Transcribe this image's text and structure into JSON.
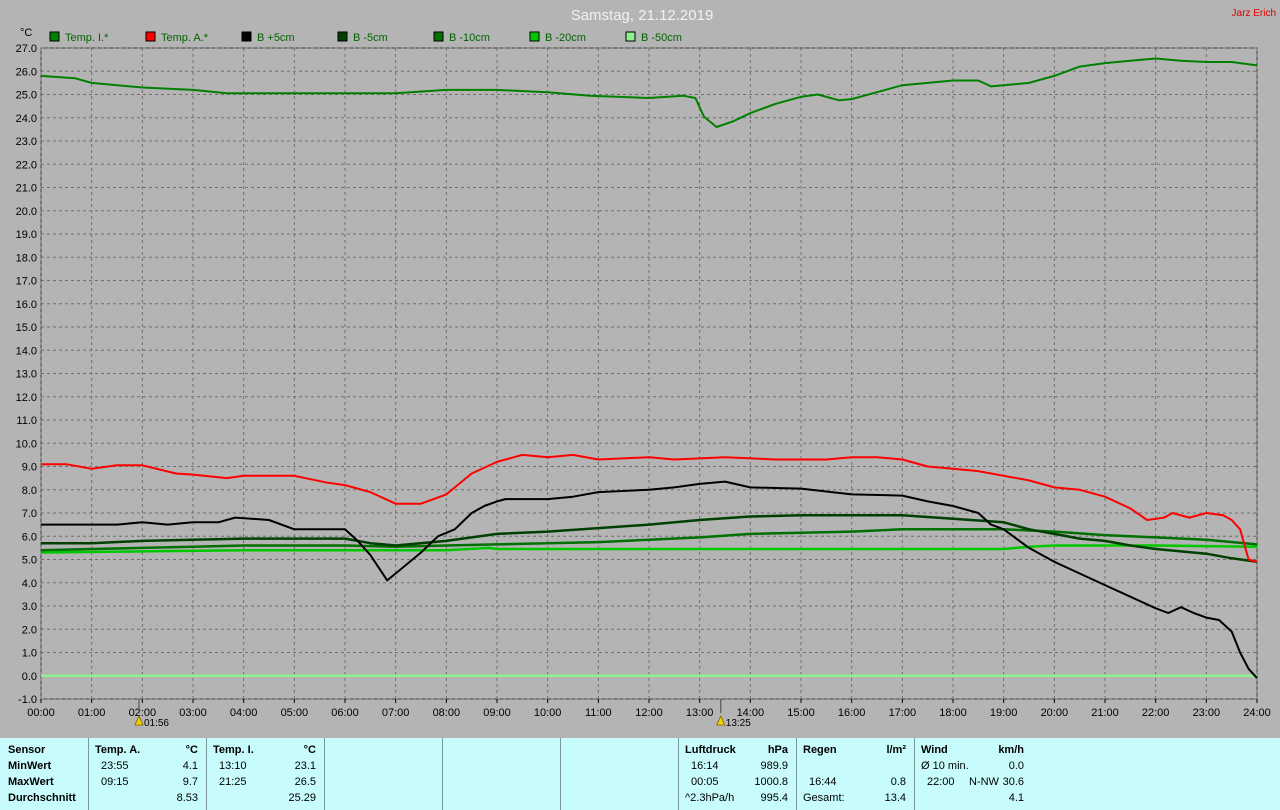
{
  "header": {
    "title": "Samstag, 21.12.2019",
    "credit": "Jarz Erich"
  },
  "colors": {
    "background": "#b4b4b4",
    "plot_background": "#b4b4b4",
    "grid": "#707070",
    "temp_inside": "#008000",
    "temp_outside": "#ff0000",
    "b_plus5": "#000000",
    "b_minus5": "#004000",
    "b_minus10": "#007000",
    "b_minus20": "#00c800",
    "b_minus50": "#90f090",
    "stats_background": "#c8fcfc"
  },
  "markers": [
    {
      "time": "01:56",
      "label": "01:56",
      "icon": "sunrise-icon"
    },
    {
      "time": "13:25",
      "label": "13:25",
      "icon": "sun-icon"
    }
  ],
  "chart_data": {
    "type": "line",
    "title": "Samstag, 21.12.2019",
    "ylabel": "°C",
    "xlabel": "",
    "xlim": [
      "00:00",
      "24:00"
    ],
    "ylim": [
      -1,
      27
    ],
    "grid": true,
    "legend_position": "top-left",
    "y_ticks": [
      "-1.0",
      "0.0",
      "1.0",
      "2.0",
      "3.0",
      "4.0",
      "5.0",
      "6.0",
      "7.0",
      "8.0",
      "9.0",
      "10.0",
      "11.0",
      "12.0",
      "13.0",
      "14.0",
      "15.0",
      "16.0",
      "17.0",
      "18.0",
      "19.0",
      "20.0",
      "21.0",
      "22.0",
      "23.0",
      "24.0",
      "25.0",
      "26.0",
      "27.0"
    ],
    "x_ticks": [
      "00:00",
      "01:00",
      "02:00",
      "03:00",
      "04:00",
      "05:00",
      "06:00",
      "07:00",
      "08:00",
      "09:00",
      "10:00",
      "11:00",
      "12:00",
      "13:00",
      "14:00",
      "15:00",
      "16:00",
      "17:00",
      "18:00",
      "19:00",
      "20:00",
      "21:00",
      "22:00",
      "23:00",
      "24:00"
    ],
    "series": [
      {
        "name": "Temp. I.*",
        "color": "#008000",
        "width": 2,
        "points": [
          [
            "00:00",
            25.8
          ],
          [
            "00:40",
            25.7
          ],
          [
            "01:00",
            25.5
          ],
          [
            "02:00",
            25.3
          ],
          [
            "03:00",
            25.2
          ],
          [
            "03:40",
            25.05
          ],
          [
            "05:00",
            25.05
          ],
          [
            "07:00",
            25.05
          ],
          [
            "08:00",
            25.2
          ],
          [
            "09:00",
            25.2
          ],
          [
            "10:00",
            25.1
          ],
          [
            "10:50",
            24.95
          ],
          [
            "12:00",
            24.85
          ],
          [
            "12:40",
            24.95
          ],
          [
            "12:55",
            24.85
          ],
          [
            "13:05",
            24.05
          ],
          [
            "13:20",
            23.6
          ],
          [
            "13:40",
            23.85
          ],
          [
            "14:00",
            24.2
          ],
          [
            "14:30",
            24.6
          ],
          [
            "15:00",
            24.9
          ],
          [
            "15:20",
            25.0
          ],
          [
            "15:45",
            24.75
          ],
          [
            "16:00",
            24.8
          ],
          [
            "16:30",
            25.1
          ],
          [
            "17:00",
            25.4
          ],
          [
            "17:30",
            25.5
          ],
          [
            "18:00",
            25.6
          ],
          [
            "18:30",
            25.6
          ],
          [
            "18:45",
            25.35
          ],
          [
            "19:00",
            25.4
          ],
          [
            "19:30",
            25.5
          ],
          [
            "20:00",
            25.8
          ],
          [
            "20:30",
            26.2
          ],
          [
            "21:00",
            26.35
          ],
          [
            "21:30",
            26.45
          ],
          [
            "22:00",
            26.55
          ],
          [
            "22:30",
            26.45
          ],
          [
            "23:00",
            26.4
          ],
          [
            "23:30",
            26.4
          ],
          [
            "24:00",
            26.25
          ]
        ]
      },
      {
        "name": "Temp. A.*",
        "color": "#ff0000",
        "width": 2,
        "points": [
          [
            "00:00",
            9.1
          ],
          [
            "00:30",
            9.1
          ],
          [
            "01:00",
            8.9
          ],
          [
            "01:30",
            9.05
          ],
          [
            "02:00",
            9.05
          ],
          [
            "02:40",
            8.7
          ],
          [
            "03:00",
            8.65
          ],
          [
            "03:40",
            8.5
          ],
          [
            "04:00",
            8.6
          ],
          [
            "05:00",
            8.6
          ],
          [
            "05:40",
            8.3
          ],
          [
            "06:00",
            8.2
          ],
          [
            "06:30",
            7.9
          ],
          [
            "07:00",
            7.4
          ],
          [
            "07:30",
            7.4
          ],
          [
            "08:00",
            7.8
          ],
          [
            "08:30",
            8.7
          ],
          [
            "09:00",
            9.2
          ],
          [
            "09:30",
            9.5
          ],
          [
            "10:00",
            9.4
          ],
          [
            "10:30",
            9.5
          ],
          [
            "11:00",
            9.3
          ],
          [
            "12:00",
            9.4
          ],
          [
            "12:30",
            9.3
          ],
          [
            "13:30",
            9.4
          ],
          [
            "14:30",
            9.3
          ],
          [
            "15:30",
            9.3
          ],
          [
            "16:00",
            9.4
          ],
          [
            "16:30",
            9.4
          ],
          [
            "17:00",
            9.3
          ],
          [
            "17:30",
            9.0
          ],
          [
            "18:00",
            8.9
          ],
          [
            "18:30",
            8.8
          ],
          [
            "19:00",
            8.6
          ],
          [
            "19:30",
            8.4
          ],
          [
            "20:00",
            8.1
          ],
          [
            "20:30",
            8.0
          ],
          [
            "21:00",
            7.7
          ],
          [
            "21:30",
            7.2
          ],
          [
            "21:50",
            6.7
          ],
          [
            "22:10",
            6.8
          ],
          [
            "22:20",
            7.0
          ],
          [
            "22:40",
            6.8
          ],
          [
            "23:00",
            7.0
          ],
          [
            "23:20",
            6.9
          ],
          [
            "23:30",
            6.7
          ],
          [
            "23:40",
            6.3
          ],
          [
            "23:50",
            5.0
          ],
          [
            "24:00",
            4.9
          ]
        ]
      },
      {
        "name": "B +5cm",
        "color": "#000000",
        "width": 2,
        "points": [
          [
            "00:00",
            6.5
          ],
          [
            "00:30",
            6.5
          ],
          [
            "01:00",
            6.5
          ],
          [
            "01:30",
            6.5
          ],
          [
            "02:00",
            6.6
          ],
          [
            "02:30",
            6.5
          ],
          [
            "03:00",
            6.6
          ],
          [
            "03:30",
            6.6
          ],
          [
            "03:50",
            6.8
          ],
          [
            "04:30",
            6.7
          ],
          [
            "05:00",
            6.3
          ],
          [
            "06:00",
            6.3
          ],
          [
            "06:15",
            5.8
          ],
          [
            "06:30",
            5.2
          ],
          [
            "06:50",
            4.1
          ],
          [
            "07:10",
            4.7
          ],
          [
            "07:30",
            5.3
          ],
          [
            "07:50",
            6.0
          ],
          [
            "08:10",
            6.3
          ],
          [
            "08:30",
            7.0
          ],
          [
            "08:45",
            7.3
          ],
          [
            "09:00",
            7.5
          ],
          [
            "09:10",
            7.6
          ],
          [
            "10:00",
            7.6
          ],
          [
            "10:30",
            7.7
          ],
          [
            "11:00",
            7.9
          ],
          [
            "12:00",
            8.0
          ],
          [
            "12:30",
            8.1
          ],
          [
            "13:00",
            8.25
          ],
          [
            "13:30",
            8.35
          ],
          [
            "14:00",
            8.1
          ],
          [
            "15:00",
            8.05
          ],
          [
            "16:00",
            7.8
          ],
          [
            "17:00",
            7.75
          ],
          [
            "17:30",
            7.5
          ],
          [
            "18:00",
            7.3
          ],
          [
            "18:30",
            7.0
          ],
          [
            "18:45",
            6.5
          ],
          [
            "19:00",
            6.3
          ],
          [
            "19:30",
            5.5
          ],
          [
            "20:00",
            4.9
          ],
          [
            "20:30",
            4.4
          ],
          [
            "21:00",
            3.9
          ],
          [
            "21:30",
            3.4
          ],
          [
            "22:00",
            2.9
          ],
          [
            "22:15",
            2.7
          ],
          [
            "22:30",
            2.95
          ],
          [
            "22:45",
            2.7
          ],
          [
            "23:00",
            2.5
          ],
          [
            "23:15",
            2.4
          ],
          [
            "23:30",
            1.9
          ],
          [
            "23:40",
            1.0
          ],
          [
            "23:50",
            0.3
          ],
          [
            "24:00",
            -0.1
          ]
        ]
      },
      {
        "name": "B -5cm",
        "color": "#004000",
        "width": 2.5,
        "points": [
          [
            "00:00",
            5.7
          ],
          [
            "01:00",
            5.7
          ],
          [
            "02:00",
            5.8
          ],
          [
            "03:00",
            5.85
          ],
          [
            "04:00",
            5.9
          ],
          [
            "05:00",
            5.9
          ],
          [
            "06:00",
            5.9
          ],
          [
            "06:30",
            5.7
          ],
          [
            "07:00",
            5.6
          ],
          [
            "08:00",
            5.8
          ],
          [
            "09:00",
            6.1
          ],
          [
            "10:00",
            6.2
          ],
          [
            "11:00",
            6.35
          ],
          [
            "12:00",
            6.5
          ],
          [
            "13:00",
            6.7
          ],
          [
            "14:00",
            6.85
          ],
          [
            "15:00",
            6.9
          ],
          [
            "16:00",
            6.9
          ],
          [
            "17:00",
            6.9
          ],
          [
            "18:00",
            6.75
          ],
          [
            "19:00",
            6.6
          ],
          [
            "19:30",
            6.3
          ],
          [
            "20:00",
            6.1
          ],
          [
            "20:30",
            5.9
          ],
          [
            "21:00",
            5.8
          ],
          [
            "21:30",
            5.6
          ],
          [
            "22:00",
            5.45
          ],
          [
            "22:30",
            5.35
          ],
          [
            "23:00",
            5.25
          ],
          [
            "23:30",
            5.05
          ],
          [
            "24:00",
            4.9
          ]
        ]
      },
      {
        "name": "B -10cm",
        "color": "#007000",
        "width": 2.5,
        "points": [
          [
            "00:00",
            5.4
          ],
          [
            "01:00",
            5.45
          ],
          [
            "02:00",
            5.5
          ],
          [
            "03:00",
            5.55
          ],
          [
            "04:00",
            5.6
          ],
          [
            "05:00",
            5.6
          ],
          [
            "06:00",
            5.6
          ],
          [
            "07:00",
            5.55
          ],
          [
            "08:00",
            5.6
          ],
          [
            "09:00",
            5.65
          ],
          [
            "10:00",
            5.7
          ],
          [
            "11:00",
            5.75
          ],
          [
            "12:00",
            5.85
          ],
          [
            "13:00",
            5.95
          ],
          [
            "14:00",
            6.1
          ],
          [
            "15:00",
            6.15
          ],
          [
            "16:00",
            6.2
          ],
          [
            "17:00",
            6.3
          ],
          [
            "18:00",
            6.3
          ],
          [
            "19:00",
            6.3
          ],
          [
            "20:00",
            6.2
          ],
          [
            "21:00",
            6.05
          ],
          [
            "22:00",
            5.95
          ],
          [
            "23:00",
            5.85
          ],
          [
            "24:00",
            5.65
          ]
        ]
      },
      {
        "name": "B -20cm",
        "color": "#00c800",
        "width": 2.5,
        "points": [
          [
            "00:00",
            5.3
          ],
          [
            "02:00",
            5.35
          ],
          [
            "04:00",
            5.4
          ],
          [
            "06:00",
            5.4
          ],
          [
            "08:00",
            5.4
          ],
          [
            "08:50",
            5.5
          ],
          [
            "09:00",
            5.45
          ],
          [
            "10:00",
            5.45
          ],
          [
            "12:00",
            5.45
          ],
          [
            "14:00",
            5.45
          ],
          [
            "16:00",
            5.45
          ],
          [
            "18:00",
            5.45
          ],
          [
            "19:00",
            5.45
          ],
          [
            "19:30",
            5.55
          ],
          [
            "20:00",
            5.6
          ],
          [
            "22:00",
            5.6
          ],
          [
            "24:00",
            5.55
          ]
        ]
      },
      {
        "name": "B -50cm",
        "color": "#90f090",
        "width": 2.5,
        "points": [
          [
            "00:00",
            0.0
          ],
          [
            "24:00",
            0.0
          ]
        ]
      }
    ]
  },
  "stats": {
    "sensor": {
      "header": "Sensor",
      "rows": [
        "MinWert",
        "MaxWert",
        "Durchschnitt"
      ]
    },
    "temp_a": {
      "header": "Temp. A.",
      "unit": "°C",
      "min_time": "23:55",
      "min_val": "4.1",
      "max_time": "09:15",
      "max_val": "9.7",
      "avg": "8.53"
    },
    "temp_i": {
      "header": "Temp. I.",
      "unit": "°C",
      "min_time": "13:10",
      "min_val": "23.1",
      "max_time": "21:25",
      "max_val": "26.5",
      "avg": "25.29"
    },
    "luftdruck": {
      "header": "Luftdruck",
      "unit": "hPa",
      "row1_label": "16:14",
      "row1_val": "989.9",
      "row2_label": "00:05",
      "row2_val": "1000.8",
      "row3_label": "^2.3hPa/h",
      "row3_val": "995.4"
    },
    "regen": {
      "header": "Regen",
      "unit": "l/m²",
      "row2_label": "16:44",
      "row2_val": "0.8",
      "row3_label": "Gesamt:",
      "row3_val": "13.4"
    },
    "wind": {
      "header": "Wind",
      "unit": "km/h",
      "row1_label": "Ø 10 min.",
      "row1_val": "0.0",
      "row2_label": "22:00",
      "row2_dir": "N-NW",
      "row2_val": "30.6",
      "row3_val": "4.1"
    }
  }
}
